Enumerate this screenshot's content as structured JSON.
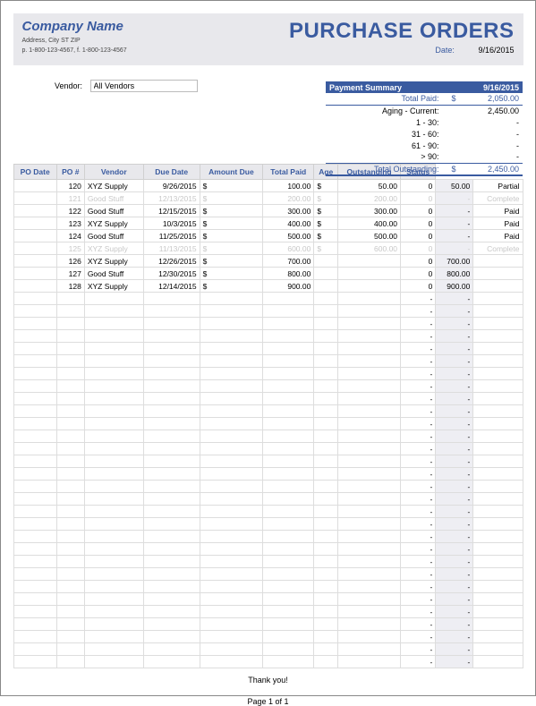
{
  "header": {
    "company": "Company Name",
    "address": "Address, City ST ZIP",
    "phone": "p. 1-800-123-4567, f. 1-800-123-4567",
    "title": "PURCHASE ORDERS",
    "date_label": "Date:",
    "date": "9/16/2015"
  },
  "vendor": {
    "label": "Vendor:",
    "value": "All Vendors"
  },
  "summary": {
    "title": "Payment Summary",
    "date": "9/16/2015",
    "total_paid_label": "Total Paid:",
    "total_paid_cur": "$",
    "total_paid": "2,050.00",
    "rows": [
      {
        "label": "Aging - Current:",
        "value": "2,450.00"
      },
      {
        "label": "1 - 30:",
        "value": "-"
      },
      {
        "label": "31 - 60:",
        "value": "-"
      },
      {
        "label": "61 - 90:",
        "value": "-"
      },
      {
        "label": "> 90:",
        "value": "-"
      }
    ],
    "outstanding_label": "Total Outstanding:",
    "outstanding_cur": "$",
    "outstanding": "2,450.00"
  },
  "cols": [
    "PO Date",
    "PO #",
    "Vendor",
    "Due Date",
    "Amount Due",
    "Total Paid",
    "Age",
    "Outstanding",
    "Status"
  ],
  "rows": [
    {
      "po": "120",
      "vendor": "XYZ Supply",
      "due": "9/26/2015",
      "amt_c": "$",
      "amt": "100.00",
      "paid_c": "$",
      "paid": "50.00",
      "age": "0",
      "out": "50.00",
      "status": "Partial"
    },
    {
      "po": "121",
      "vendor": "Good Stuff",
      "due": "12/13/2015",
      "amt_c": "$",
      "amt": "200.00",
      "paid_c": "$",
      "paid": "200.00",
      "age": "0",
      "out": "-",
      "status": "Complete",
      "faded": true
    },
    {
      "po": "122",
      "vendor": "Good Stuff",
      "due": "12/15/2015",
      "amt_c": "$",
      "amt": "300.00",
      "paid_c": "$",
      "paid": "300.00",
      "age": "0",
      "out": "-",
      "status": "Paid"
    },
    {
      "po": "123",
      "vendor": "XYZ Supply",
      "due": "10/3/2015",
      "amt_c": "$",
      "amt": "400.00",
      "paid_c": "$",
      "paid": "400.00",
      "age": "0",
      "out": "-",
      "status": "Paid"
    },
    {
      "po": "124",
      "vendor": "Good Stuff",
      "due": "11/25/2015",
      "amt_c": "$",
      "amt": "500.00",
      "paid_c": "$",
      "paid": "500.00",
      "age": "0",
      "out": "-",
      "status": "Paid"
    },
    {
      "po": "125",
      "vendor": "XYZ Supply",
      "due": "11/13/2015",
      "amt_c": "$",
      "amt": "600.00",
      "paid_c": "$",
      "paid": "600.00",
      "age": "0",
      "out": "-",
      "status": "Complete",
      "faded": true
    },
    {
      "po": "126",
      "vendor": "XYZ Supply",
      "due": "12/26/2015",
      "amt_c": "$",
      "amt": "700.00",
      "paid_c": "",
      "paid": "",
      "age": "0",
      "out": "700.00",
      "status": ""
    },
    {
      "po": "127",
      "vendor": "Good Stuff",
      "due": "12/30/2015",
      "amt_c": "$",
      "amt": "800.00",
      "paid_c": "",
      "paid": "",
      "age": "0",
      "out": "800.00",
      "status": ""
    },
    {
      "po": "128",
      "vendor": "XYZ Supply",
      "due": "12/14/2015",
      "amt_c": "$",
      "amt": "900.00",
      "paid_c": "",
      "paid": "",
      "age": "0",
      "out": "900.00",
      "status": ""
    }
  ],
  "empty_rows": 30,
  "footer": {
    "thanks": "Thank you!",
    "page": "Page 1 of 1"
  }
}
